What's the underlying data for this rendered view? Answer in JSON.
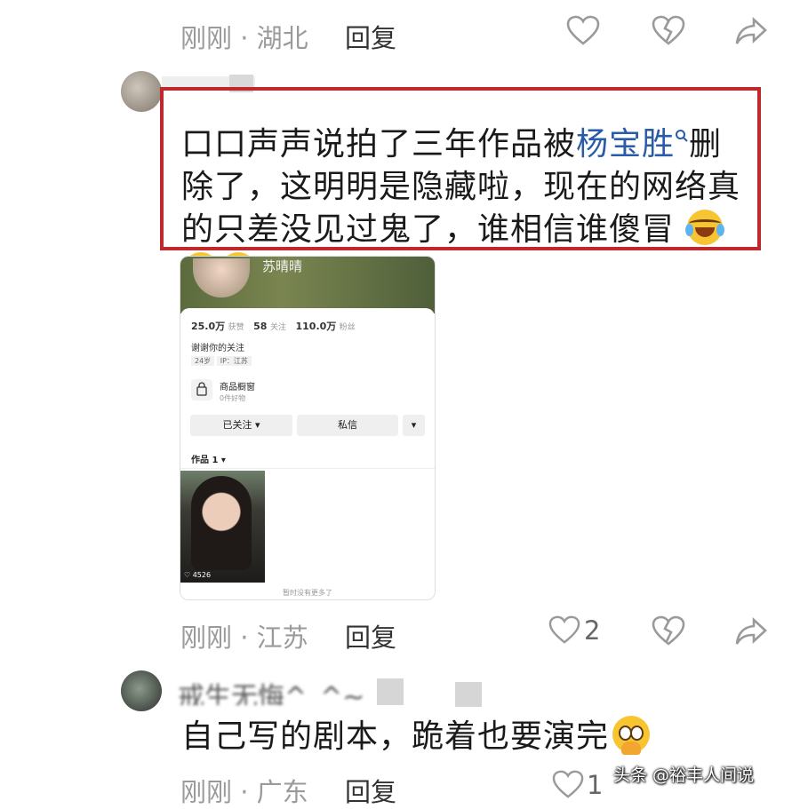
{
  "colors": {
    "highlight_border": "#c0282b",
    "link": "#2a5ba8",
    "meta": "#9a9a9a"
  },
  "top": {
    "meta": "刚刚 · 湖北",
    "reply": "回复"
  },
  "comment1": {
    "text_a": "口口声声说拍了三年作品被",
    "link": "杨宝胜",
    "text_b": "删除了，这明明是隐藏啦，现在的网络真的只差没见过鬼了，谁相信谁傻冒",
    "emoji": "grinning-squinting-tears-emoji"
  },
  "profile": {
    "name": "苏晴晴",
    "likes_value": "25.0万",
    "likes_label": "获赞",
    "following_value": "58",
    "following_label": "关注",
    "fans_value": "110.0万",
    "fans_label": "粉丝",
    "bio": "谢谢你的关注",
    "age": "24岁",
    "ip": "IP：江苏",
    "shop_title": "商品橱窗",
    "shop_sub": "0件好物",
    "btn_followed": "已关注 ▾",
    "btn_message": "私信",
    "btn_more": "▾",
    "works_tab": "作品 1 ▾",
    "video_likes": "4526",
    "no_more": "暂时没有更多了"
  },
  "comment1_footer": {
    "meta": "刚刚 · 江苏",
    "reply": "回复",
    "like_count": "2"
  },
  "comment2": {
    "username": "戒生无悔^_^~",
    "text": "自己写的剧本，跪着也要演完",
    "emoji": "hand-over-mouth-emoji"
  },
  "comment2_footer": {
    "meta": "刚刚 · 广东",
    "reply": "回复",
    "like_count": "1"
  },
  "watermark": "头条 @裕丰人间说"
}
